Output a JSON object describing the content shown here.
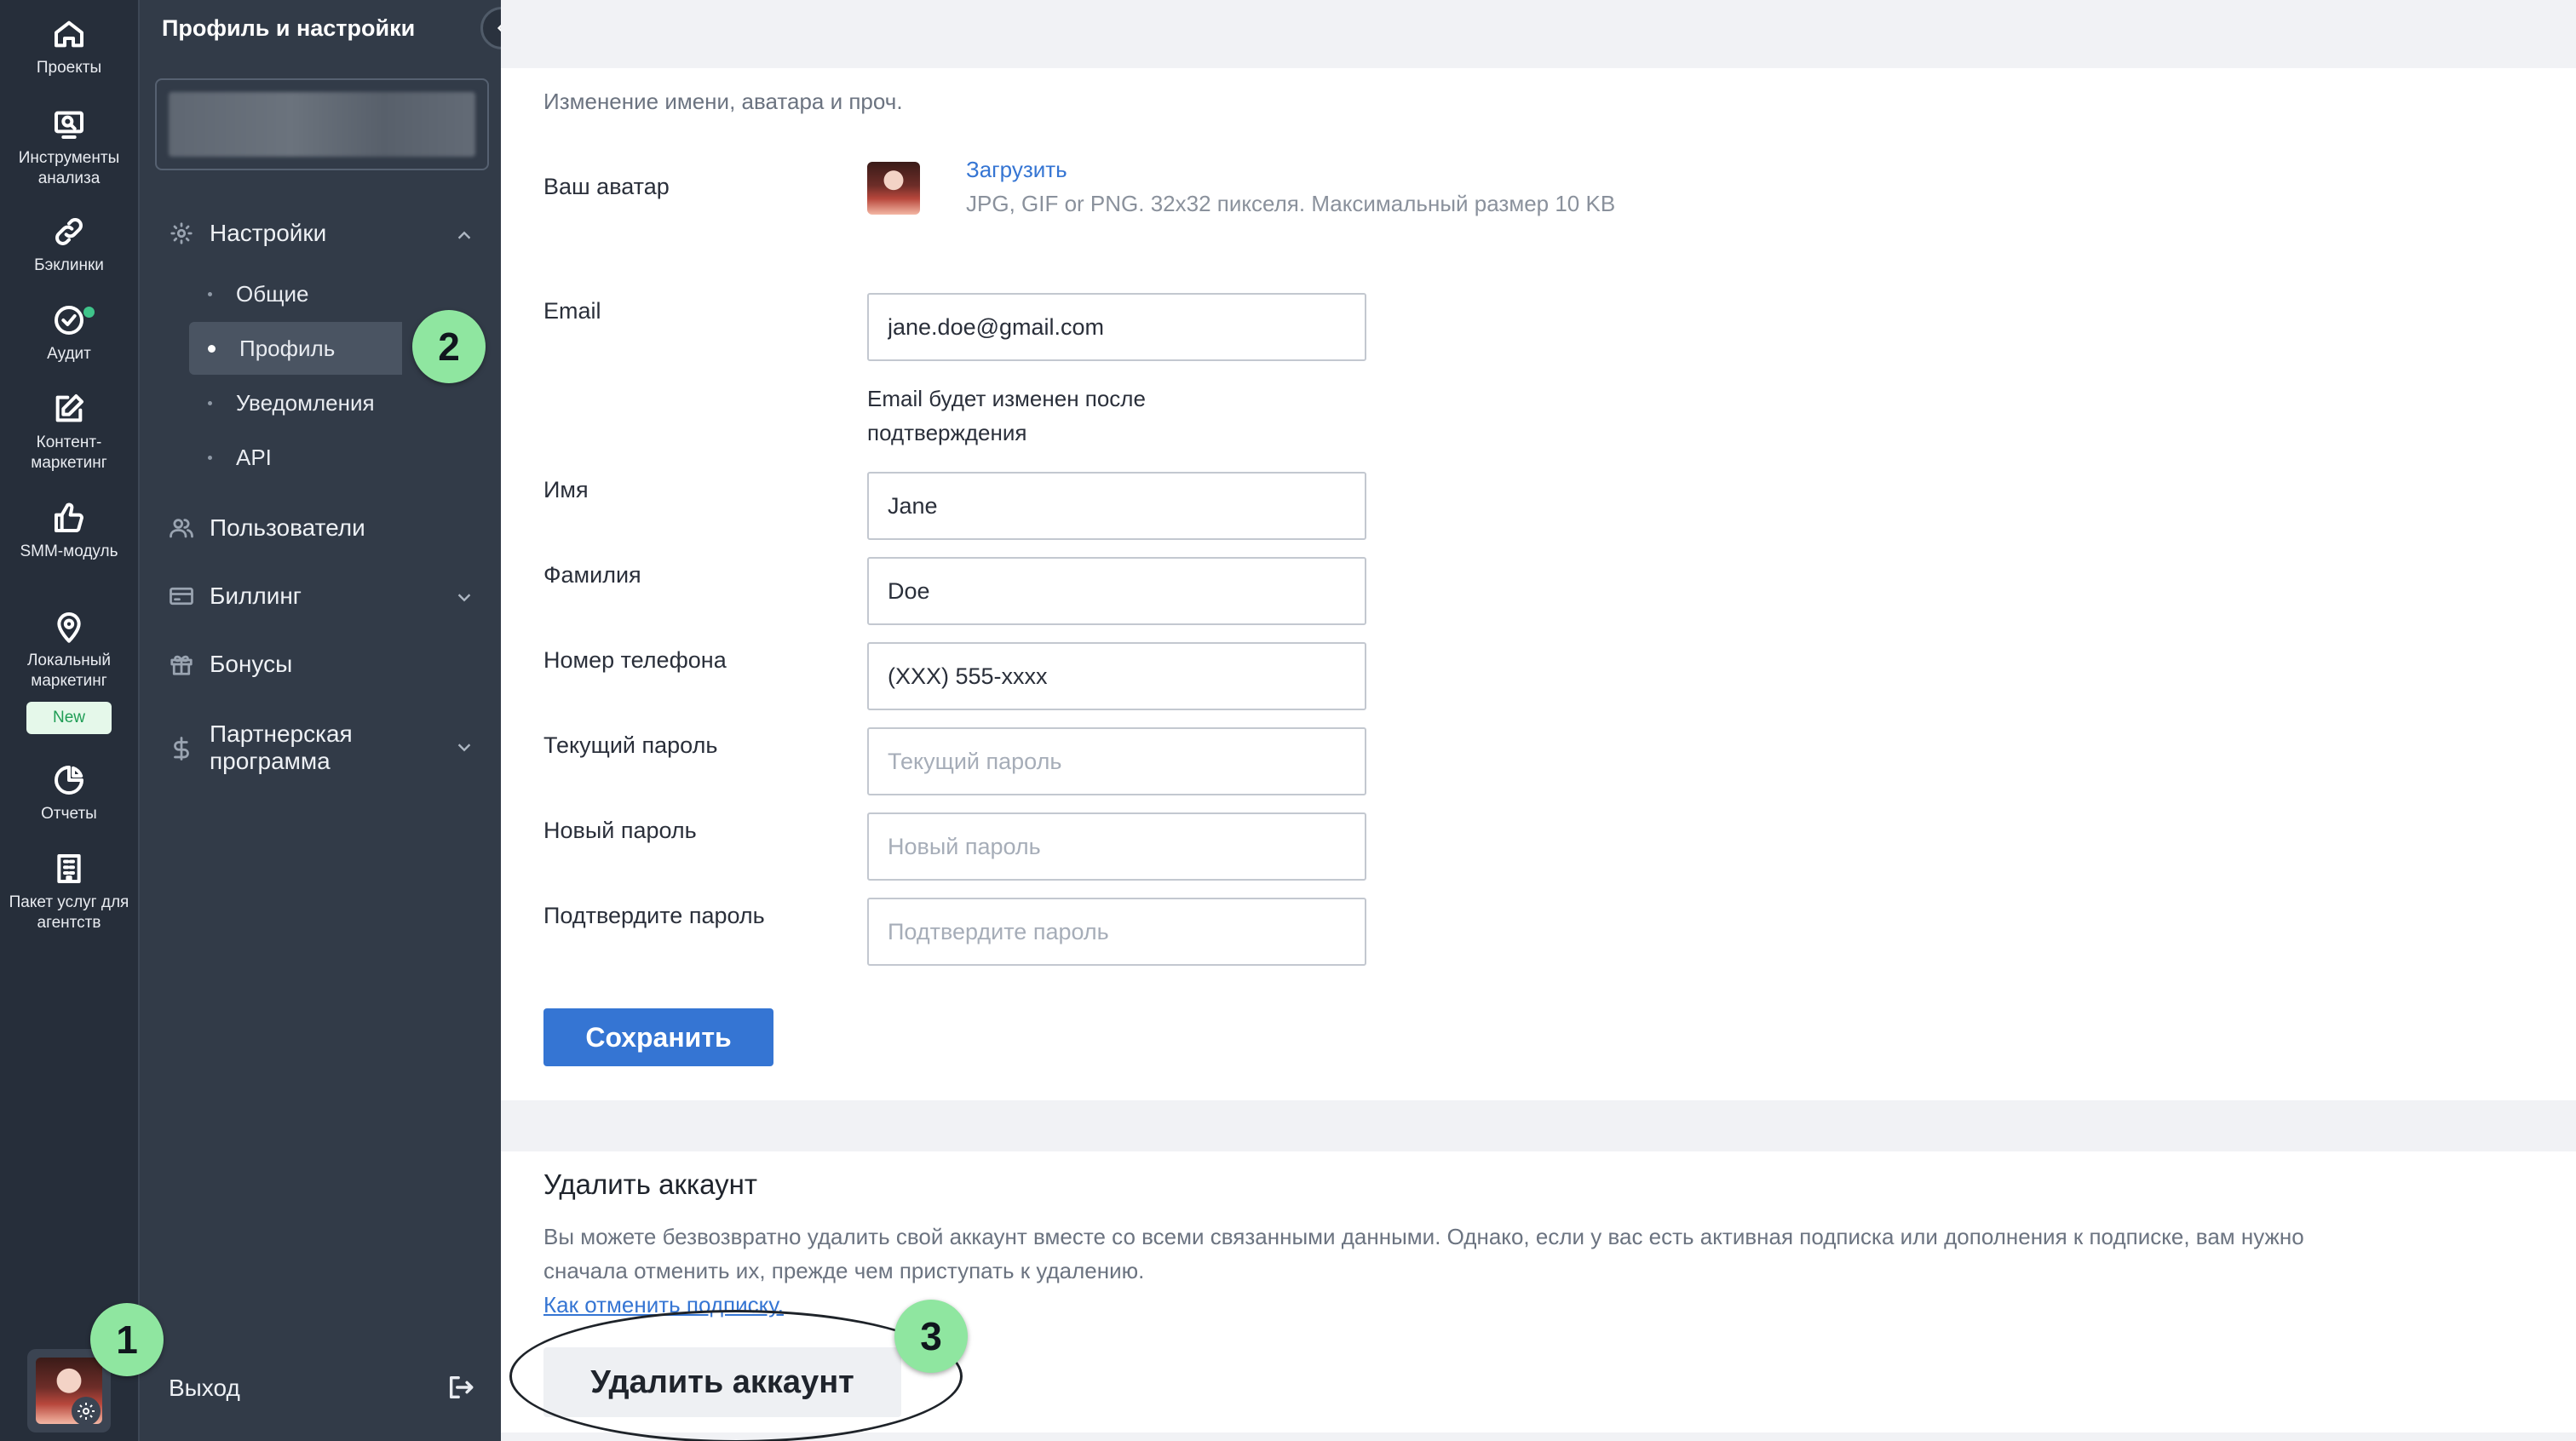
{
  "rail": {
    "items": [
      {
        "label": "Проекты",
        "icon": "home-icon"
      },
      {
        "label": "Инструменты анализа",
        "icon": "monitor-icon"
      },
      {
        "label": "Бэклинки",
        "icon": "link-icon"
      },
      {
        "label": "Аудит",
        "icon": "check-circle-icon"
      },
      {
        "label": "Контент-маркетинг",
        "icon": "edit-icon"
      },
      {
        "label": "SMM-модуль",
        "icon": "thumbs-up-icon"
      },
      {
        "label": "Локальный маркетинг",
        "icon": "map-pin-icon",
        "badge": "New"
      },
      {
        "label": "Отчеты",
        "icon": "pie-chart-icon"
      },
      {
        "label": "Пакет услуг для агентств",
        "icon": "building-icon"
      }
    ]
  },
  "sidebar": {
    "title": "Профиль и настройки",
    "settings_label": "Настройки",
    "sub_items": [
      "Общие",
      "Профиль",
      "Уведомления",
      "API"
    ],
    "active_sub_item": "Профиль",
    "users_label": "Пользователи",
    "billing_label": "Биллинг",
    "bonus_label": "Бонусы",
    "partner_label": "Партнерская программа",
    "logout_label": "Выход"
  },
  "profile": {
    "subtitle": "Изменение имени, аватара и проч.",
    "avatar_label": "Ваш аватар",
    "upload_label": "Загрузить",
    "upload_hint": "JPG, GIF or PNG. 32x32 пикселя. Максимальный размер 10 KB",
    "email_label": "Email",
    "email_value": "jane.doe@gmail.com",
    "email_note_line1": "Email будет изменен после",
    "email_note_line2": "подтверждения",
    "first_name_label": "Имя",
    "first_name_value": "Jane",
    "last_name_label": "Фамилия",
    "last_name_value": "Doe",
    "phone_label": "Номер телефона",
    "phone_value": "(XXX) 555-xxxx",
    "current_password_label": "Текущий пароль",
    "current_password_placeholder": "Текущий пароль",
    "new_password_label": "Новый пароль",
    "new_password_placeholder": "Новый пароль",
    "confirm_password_label": "Подтвердите пароль",
    "confirm_password_placeholder": "Подтвердите пароль",
    "save_label": "Сохранить"
  },
  "delete_account": {
    "title": "Удалить аккаунт",
    "text_line1": "Вы можете безвозвратно удалить свой аккаунт вместе со всеми связанными данными. Однако, если у вас есть активная подписка или дополнения к подписке, вам нужно",
    "text_line2": "сначала отменить их, прежде чем приступать к удалению.",
    "cancel_link": "Как отменить подписку.",
    "button_label": "Удалить аккаунт"
  },
  "callouts": [
    "1",
    "2",
    "3"
  ],
  "colors": {
    "rail_bg": "#262e3a",
    "sidebar_bg": "#323b48",
    "primary": "#3575d3",
    "link": "#3575d3",
    "callout": "#8fe6a0",
    "new_badge": "#e5f8ea"
  }
}
